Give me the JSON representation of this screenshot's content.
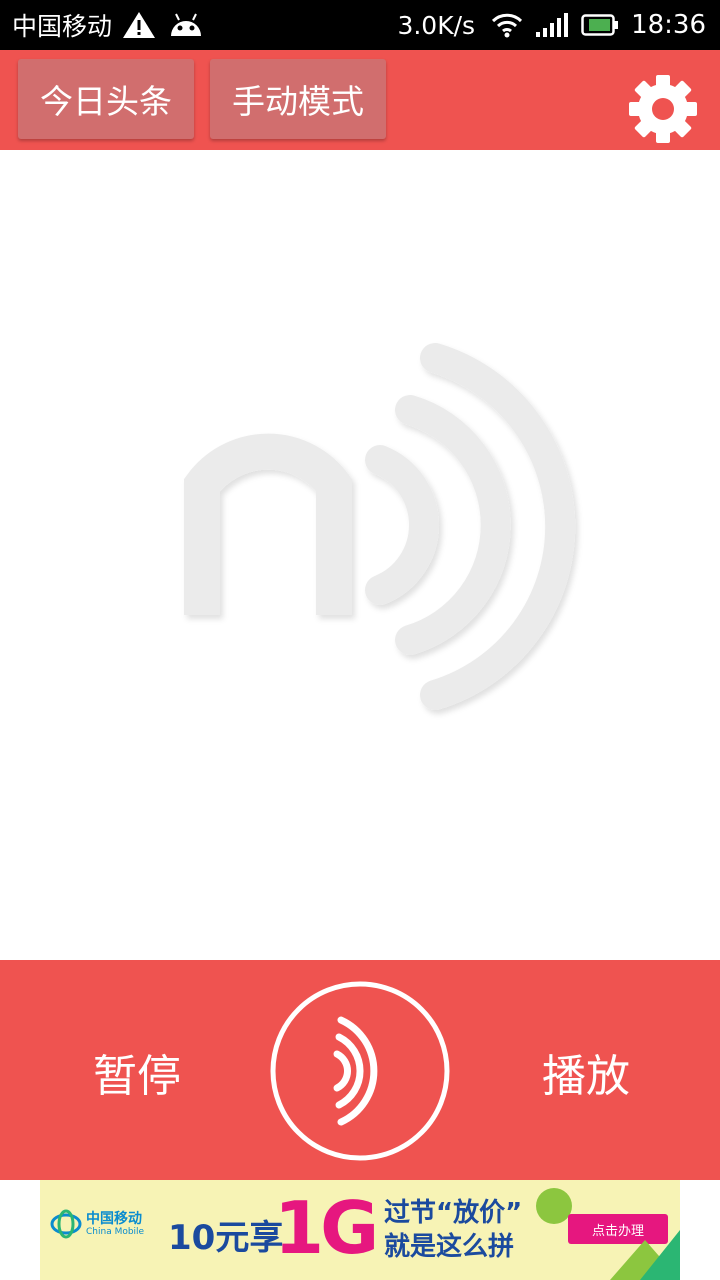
{
  "status_bar": {
    "carrier": "中国移动",
    "network_speed": "3.0K/s",
    "time": "18:36",
    "icons": [
      "warning-icon",
      "android-icon",
      "wifi-icon",
      "signal-icon",
      "battery-icon"
    ]
  },
  "toolbar": {
    "source_button": "今日头条",
    "mode_button": "手动模式",
    "settings_icon": "gear-icon"
  },
  "main": {
    "watermark_icon": "sound-wave-logo-icon"
  },
  "controls": {
    "pause_label": "暂停",
    "play_label": "播放",
    "center_icon": "sound-wave-icon"
  },
  "ad": {
    "brand_cn": "中国移动",
    "brand_en": "China Mobile",
    "offer": "10元享",
    "highlight": "1G",
    "line1": "过节“放价”",
    "line2": "就是这么拼",
    "cta": "点击办理"
  },
  "colors": {
    "primary": "#ef5350",
    "button_bg": "#d16e6e",
    "watermark": "#ebebeb",
    "ad_bg": "#f7f3b5",
    "ad_pink": "#e6177f",
    "ad_blue": "#1b4a9e"
  }
}
